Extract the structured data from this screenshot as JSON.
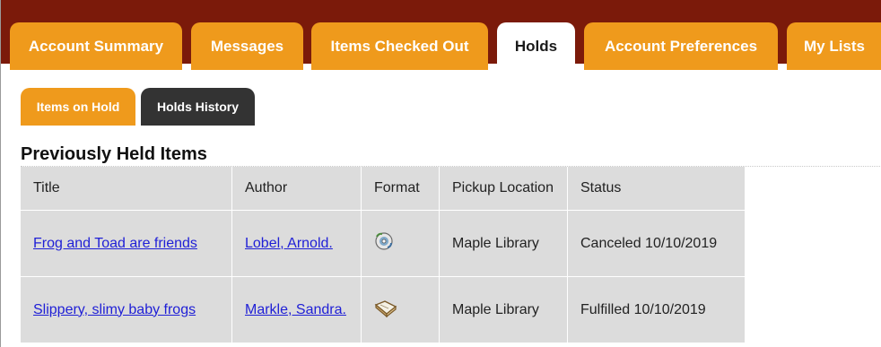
{
  "main_tabs": [
    {
      "label": "Account Summary"
    },
    {
      "label": "Messages"
    },
    {
      "label": "Items Checked Out"
    },
    {
      "label": "Holds"
    },
    {
      "label": "Account Preferences"
    },
    {
      "label": "My Lists"
    }
  ],
  "sub_tabs": [
    {
      "label": "Items on Hold"
    },
    {
      "label": "Holds History"
    }
  ],
  "section_title": "Previously Held Items",
  "table": {
    "headers": [
      "Title",
      "Author",
      "Format",
      "Pickup Location",
      "Status"
    ],
    "rows": [
      {
        "title": "Frog and Toad are friends",
        "author": "Lobel, Arnold.",
        "format_icon": "audiobook-cd-icon",
        "pickup": "Maple Library",
        "status": "Canceled 10/10/2019"
      },
      {
        "title": "Slippery, slimy baby frogs",
        "author": "Markle, Sandra.",
        "format_icon": "book-icon",
        "pickup": "Maple Library",
        "status": "Fulfilled 10/10/2019"
      }
    ]
  },
  "colors": {
    "tab_bar_bg": "#7b1a0a",
    "tab_orange": "#ef9a1c",
    "subtab_dark": "#333333",
    "table_bg": "#dcdcdc",
    "link": "#1f1fd6"
  }
}
